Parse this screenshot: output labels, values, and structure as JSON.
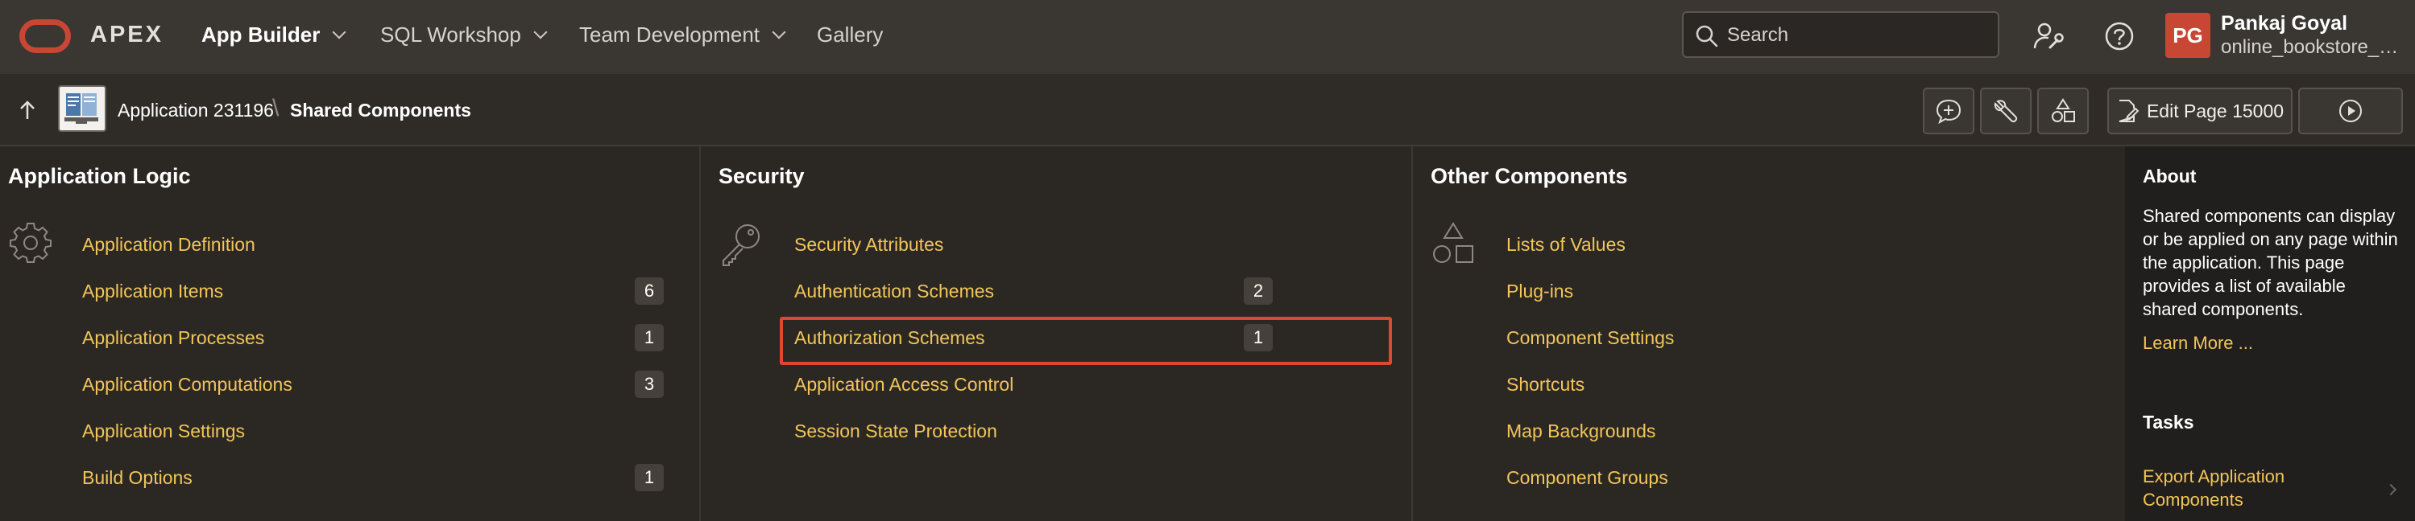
{
  "topnav": {
    "brand": "APEX",
    "items": [
      {
        "label": "App Builder",
        "active": true,
        "has_menu": true
      },
      {
        "label": "SQL Workshop",
        "has_menu": true
      },
      {
        "label": "Team Development",
        "has_menu": true
      },
      {
        "label": "Gallery",
        "has_menu": false
      }
    ],
    "search_placeholder": "Search",
    "user": {
      "initials": "PG",
      "name": "Pankaj Goyal",
      "workspace": "online_bookstore_a..."
    }
  },
  "breadcrumb": {
    "application": "Application 231196",
    "separator": "\\",
    "current": "Shared Components"
  },
  "toolbar": {
    "edit_page_label": "Edit Page 15000"
  },
  "columns": [
    {
      "title": "Application Logic",
      "icon": "gear-icon",
      "links": [
        {
          "label": "Application Definition",
          "count": ""
        },
        {
          "label": "Application Items",
          "count": "6"
        },
        {
          "label": "Application Processes",
          "count": "1"
        },
        {
          "label": "Application Computations",
          "count": "3"
        },
        {
          "label": "Application Settings",
          "count": ""
        },
        {
          "label": "Build Options",
          "count": "1"
        }
      ]
    },
    {
      "title": "Security",
      "icon": "key-icon",
      "links": [
        {
          "label": "Security Attributes",
          "count": ""
        },
        {
          "label": "Authentication Schemes",
          "count": "2"
        },
        {
          "label": "Authorization Schemes",
          "count": "1",
          "highlighted": true
        },
        {
          "label": "Application Access Control",
          "count": ""
        },
        {
          "label": "Session State Protection",
          "count": ""
        }
      ]
    },
    {
      "title": "Other Components",
      "icon": "shapes-icon",
      "links": [
        {
          "label": "Lists of Values",
          "count": ""
        },
        {
          "label": "Plug-ins",
          "count": ""
        },
        {
          "label": "Component Settings",
          "count": ""
        },
        {
          "label": "Shortcuts",
          "count": ""
        },
        {
          "label": "Map Backgrounds",
          "count": ""
        },
        {
          "label": "Component Groups",
          "count": ""
        }
      ]
    }
  ],
  "about": {
    "title": "About",
    "text": "Shared components can display or be applied on any page within the application. This page provides a list of available shared components.",
    "learn_more": "Learn More ..."
  },
  "tasks": {
    "title": "Tasks",
    "items": [
      "Export Application Components"
    ]
  },
  "colors": {
    "accent_red": "#c74634",
    "link_yellow": "#f2c558",
    "highlight_border": "#dc4930"
  }
}
